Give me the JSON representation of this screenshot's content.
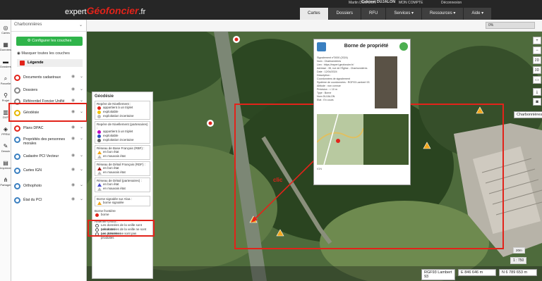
{
  "header": {
    "logo_prefix": "expert",
    "logo_brand": "Géofoncier",
    "logo_suffix": ".fr",
    "user_name": "Martin DUJALON",
    "cabinet": "Cabinet DUJALON",
    "account": "MON COMPTE",
    "logout": "Déconnexion",
    "tabs": [
      {
        "label": "Cartes"
      },
      {
        "label": "Dossiers"
      },
      {
        "label": "RFU"
      },
      {
        "label": "Services ▾"
      },
      {
        "label": "Ressources ▾"
      },
      {
        "label": "Aide ▾"
      }
    ]
  },
  "progress": {
    "label": "0%",
    "value": 0
  },
  "rail": [
    {
      "label": "Cartes",
      "icon": "globe-icon"
    },
    {
      "label": "Données",
      "icon": "map-icon"
    },
    {
      "label": "Dossiers",
      "icon": "folder-icon"
    },
    {
      "label": "Parcelle",
      "icon": "search-icon"
    },
    {
      "label": "Projet",
      "icon": "pin-icon"
    },
    {
      "label": "DVF",
      "icon": "chart-icon"
    },
    {
      "label": "PPRM",
      "icon": "layers-icon"
    },
    {
      "label": "Dessin",
      "icon": "pencil-icon"
    },
    {
      "label": "Imprimer",
      "icon": "printer-icon"
    },
    {
      "label": "Partager",
      "icon": "share-icon"
    }
  ],
  "panel": {
    "context": "Charbonnières",
    "configure_button": "Configurer les couches",
    "hide_all": "Masquer toutes les couches",
    "legend": "Légende",
    "layers": [
      {
        "label": "Documents cadastraux",
        "color": "#e2231a"
      },
      {
        "label": "Dossiers",
        "color": "#888888"
      },
      {
        "label": "Référentiel Foncier Unifié",
        "color": "#888888"
      },
      {
        "label": "Géodésie",
        "color": "#e6b800"
      },
      {
        "label": "Plans DPAC",
        "color": "#e2231a"
      },
      {
        "label": "Propriétés des personnes morales",
        "color": "#3a7fc0"
      },
      {
        "label": "Cadastre PCI Vecteur",
        "color": "#3a7fc0"
      },
      {
        "label": "Cartes IGN",
        "color": "#3a7fc0"
      },
      {
        "label": "Orthophoto",
        "color": "#3a7fc0"
      },
      {
        "label": "État du PCI",
        "color": "#3a7fc0"
      }
    ]
  },
  "geodesie": {
    "title": "Géodésie",
    "repere_nivellement": "Repère de Nivellement :",
    "rn_items": [
      "appartient à un triplet",
      "exploitable",
      "exploitation incertaine"
    ],
    "repere_partenaires": "Repère de Nivellement (partenaires) :",
    "rp_items": [
      "appartient à un triplet",
      "exploitable",
      "exploitation incertaine"
    ],
    "rbf": "Réseau de Base Français (RBF) :",
    "rbf_items": [
      "en bon état",
      "en mauvais état"
    ],
    "rdf": "Réseau de Détail Français (RDF) :",
    "rdf_items": [
      "en bon état",
      "en mauvais état"
    ],
    "rdp": "Réseau de Détail (partenaires) :",
    "rdp_items": [
      "en bon état",
      "en mauvais état"
    ],
    "borne_aloa": "Borne signalée sur Aloa :",
    "borne_aloa_item": "borne signalée",
    "borne_frontiere": "Borne frontière",
    "borne_frontiere_item": "borne",
    "antennes": "Antenne GNSS :",
    "antennes_items": [
      "Les données de la veille sont présentes",
      "Les données de la veille ne sont pas présentes",
      "Les données ne sont pas produites"
    ]
  },
  "card": {
    "title": "Borne de propriété",
    "lines": [
      "Signalement n°0000 (2024)",
      "Nom : Charbonnières",
      "Lien : https://expert.geofoncier.fr/",
      "Adresse : 35, rue de l'Église - Charbonnières",
      "Date : 12/04/2024",
      "Description :",
      "Coordonnées de signalement",
      "Système de coordonnées : RGF93 Lambert 93",
      "Altitude : non connue",
      "Précision : < 10 m",
      "Type : Borne",
      "Nom DUJALON",
      "Etat : En cours"
    ],
    "scale": "IGN"
  },
  "annotation": {
    "label": "clic"
  },
  "map": {
    "place_tag": "Charbonnières",
    "projection": "RGF93 Lambert 93",
    "easting": "E 846 646 m",
    "northing": "N 6 789 653 m",
    "scale": "1 : 750",
    "scalebar": "20m"
  },
  "map_buttons": [
    "+",
    "−",
    "2D",
    "3D"
  ]
}
